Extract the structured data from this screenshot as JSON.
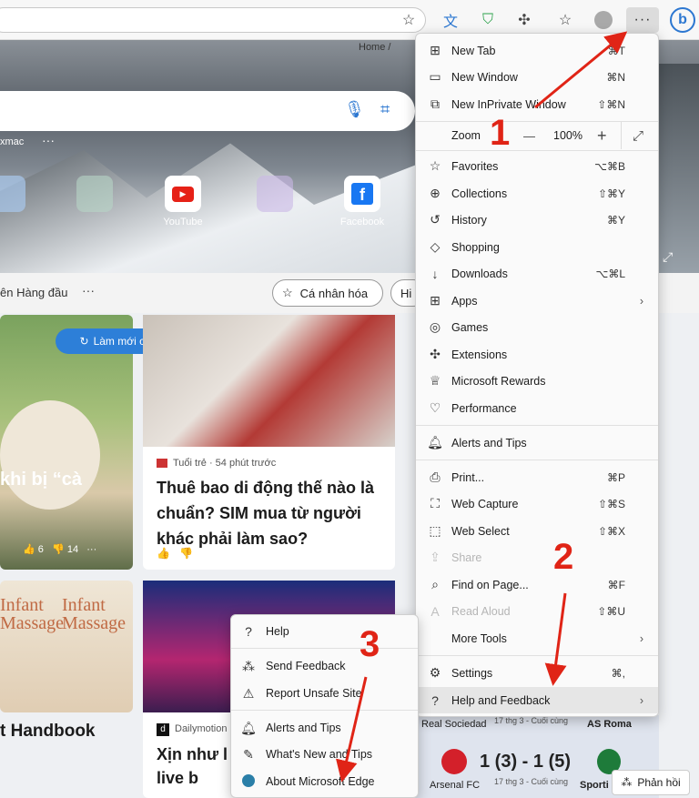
{
  "toolbar": {
    "icons": [
      "favorites-add-icon",
      "translate-icon",
      "shield-icon",
      "extensions-icon",
      "favorites-icon",
      "profile-icon",
      "more-icon",
      "bing-icon"
    ],
    "more_glyph": "···",
    "bing_glyph": "b"
  },
  "hero": {
    "user": "xmac",
    "tiles": [
      {
        "label": "YouTube"
      },
      {
        "label": "Facebook"
      }
    ]
  },
  "breadcrumb": {
    "home": "Home"
  },
  "nav": {
    "text": "ên Hàng đầu",
    "personalize": "Cá nhân hóa",
    "hi": "Hi"
  },
  "feed": {
    "refresh": "Làm mới câu chuyện",
    "card1": {
      "title": "khi bị “cà",
      "likes": "6",
      "dislikes": "14"
    },
    "card2": {
      "source": "Tuổi trẻ · 54 phút trước",
      "title": "Thuê bao di động thế nào là chuẩn? SIM mua từ người khác phải làm sao?"
    },
    "card3": {
      "book1": "Infant Massage",
      "book2": "Infant Massage",
      "title": "t Handbook"
    },
    "card4": {
      "source_icon": "d",
      "source": "Dailymotion",
      "title": "Xịn như l hát live b"
    },
    "sports": {
      "left_team": "Real Sociedad",
      "date1": "17 thg 3 - Cuối cùng",
      "right_team": "AS Roma",
      "team_a": "Arsenal FC",
      "score": "1 (3) - 1 (5)",
      "date2": "17 thg 3 - Cuối cùng",
      "team_b": "Sporti"
    },
    "feedback": "Phản hồi"
  },
  "menu": {
    "items": [
      {
        "icon": "new-tab-icon",
        "label": "New Tab",
        "shortcut": "⌘T"
      },
      {
        "icon": "new-window-icon",
        "label": "New Window",
        "shortcut": "⌘N"
      },
      {
        "icon": "inprivate-icon",
        "label": "New InPrivate Window",
        "shortcut": "⇧⌘N"
      },
      {
        "icon": "favorites-icon",
        "label": "Favorites",
        "shortcut": "⌥⌘B"
      },
      {
        "icon": "collections-icon",
        "label": "Collections",
        "shortcut": "⇧⌘Y"
      },
      {
        "icon": "history-icon",
        "label": "History",
        "shortcut": "⌘Y"
      },
      {
        "icon": "shopping-icon",
        "label": "Shopping",
        "shortcut": ""
      },
      {
        "icon": "downloads-icon",
        "label": "Downloads",
        "shortcut": "⌥⌘L"
      },
      {
        "icon": "apps-icon",
        "label": "Apps",
        "shortcut": ""
      },
      {
        "icon": "games-icon",
        "label": "Games",
        "shortcut": ""
      },
      {
        "icon": "extensions-icon",
        "label": "Extensions",
        "shortcut": ""
      },
      {
        "icon": "rewards-icon",
        "label": "Microsoft Rewards",
        "shortcut": ""
      },
      {
        "icon": "performance-icon",
        "label": "Performance",
        "shortcut": ""
      },
      {
        "icon": "alerts-icon",
        "label": "Alerts and Tips",
        "shortcut": ""
      },
      {
        "icon": "print-icon",
        "label": "Print...",
        "shortcut": "⌘P"
      },
      {
        "icon": "web-capture-icon",
        "label": "Web Capture",
        "shortcut": "⇧⌘S"
      },
      {
        "icon": "web-select-icon",
        "label": "Web Select",
        "shortcut": "⇧⌘X"
      },
      {
        "icon": "share-icon",
        "label": "Share",
        "shortcut": ""
      },
      {
        "icon": "find-icon",
        "label": "Find on Page...",
        "shortcut": "⌘F"
      },
      {
        "icon": "read-aloud-icon",
        "label": "Read Aloud",
        "shortcut": "⇧⌘U"
      },
      {
        "icon": "more-tools-icon",
        "label": "More Tools",
        "shortcut": ""
      },
      {
        "icon": "settings-icon",
        "label": "Settings",
        "shortcut": "⌘,"
      },
      {
        "icon": "help-icon",
        "label": "Help and Feedback",
        "shortcut": ""
      }
    ],
    "zoom": {
      "label": "Zoom",
      "minus": "—",
      "value": "100%",
      "plus": "+"
    }
  },
  "submenu": {
    "items": [
      {
        "icon": "help-icon",
        "label": "Help"
      },
      {
        "icon": "feedback-icon",
        "label": "Send Feedback"
      },
      {
        "icon": "warning-icon",
        "label": "Report Unsafe Site"
      },
      {
        "icon": "alerts-icon",
        "label": "Alerts and Tips"
      },
      {
        "icon": "whats-new-icon",
        "label": "What's New and Tips"
      },
      {
        "icon": "edge-icon",
        "label": "About Microsoft Edge"
      }
    ]
  },
  "annotations": {
    "step1": "1",
    "step2": "2",
    "step3": "3",
    "color": "#e02416"
  }
}
